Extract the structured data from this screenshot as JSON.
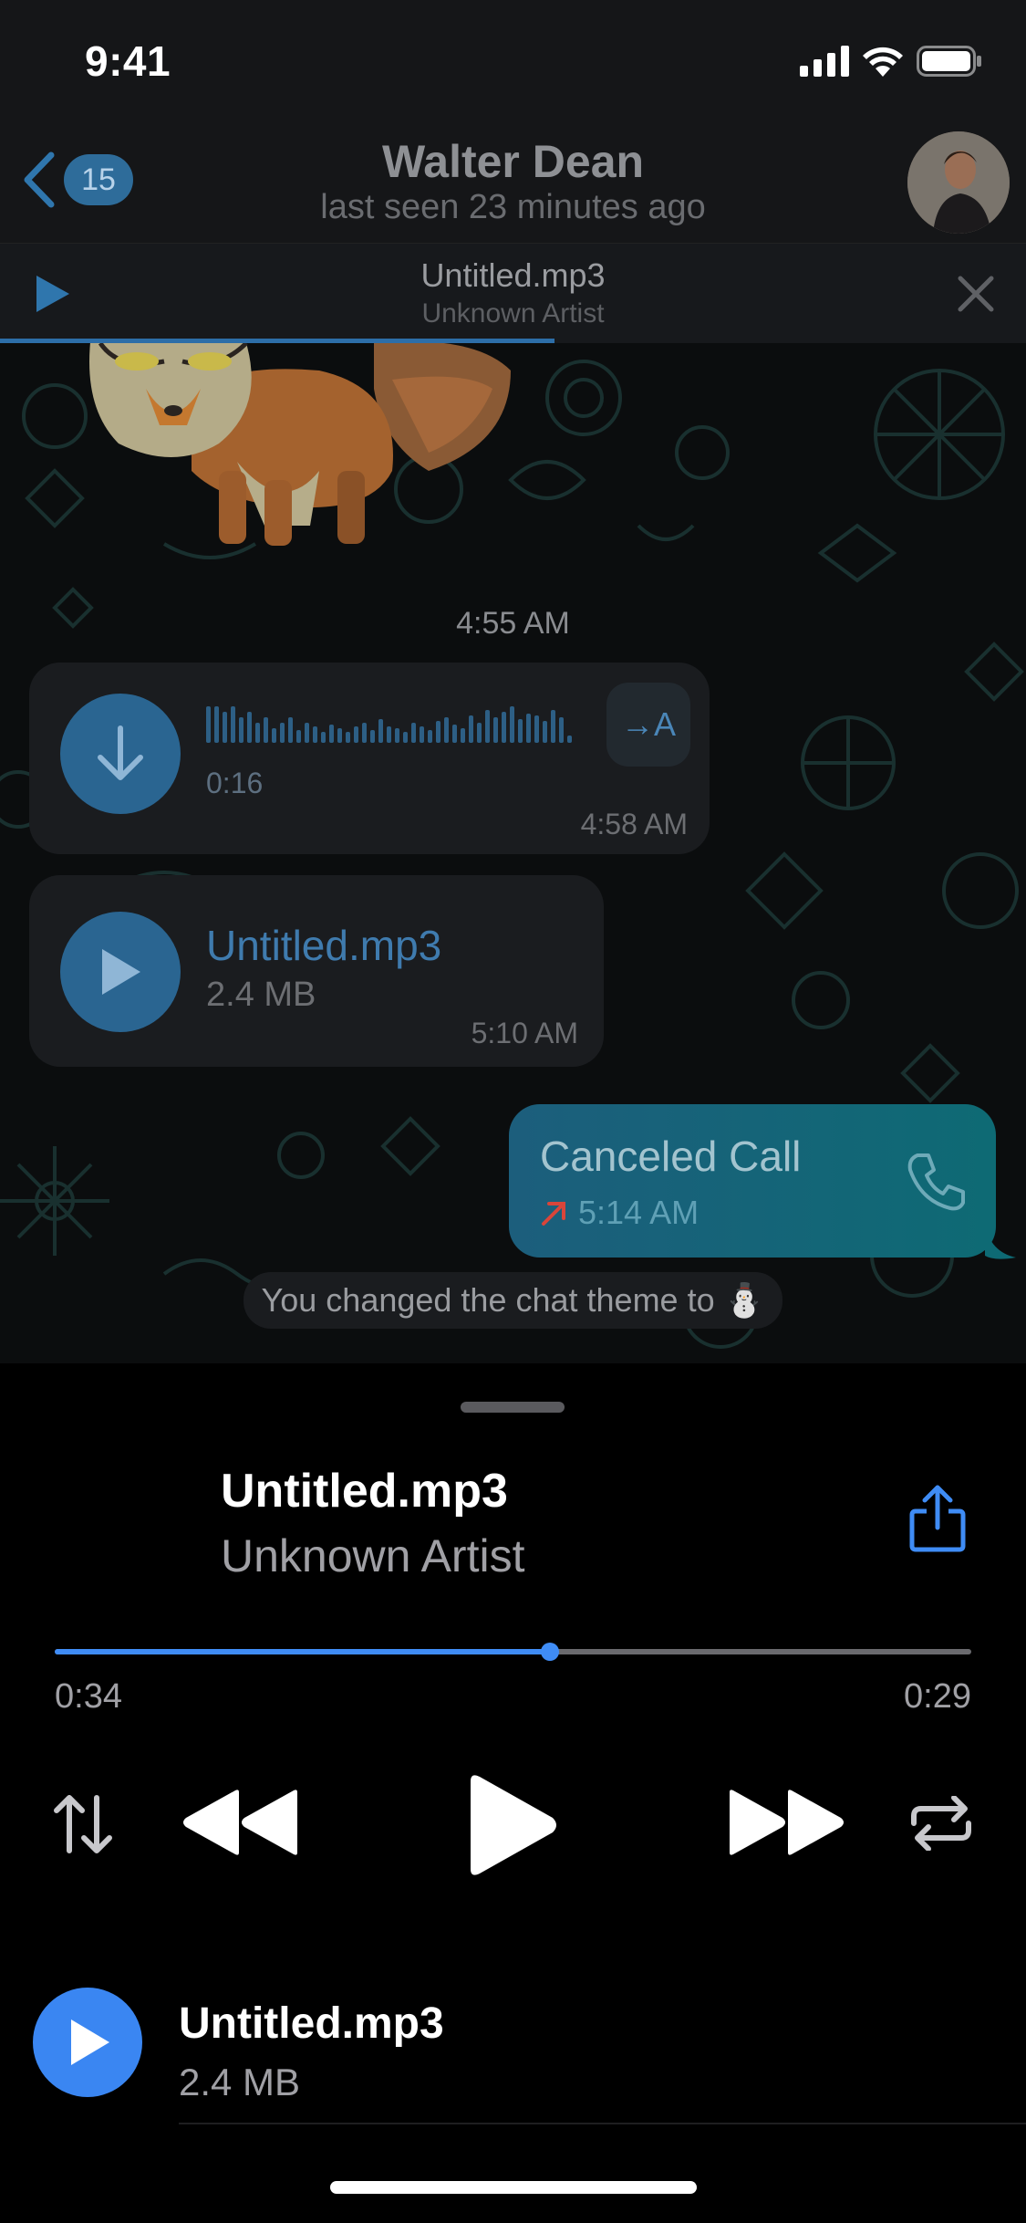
{
  "status_bar": {
    "time": "9:41",
    "icons": [
      "signal-icon",
      "wifi-icon",
      "battery-icon"
    ]
  },
  "header": {
    "back_badge": "15",
    "title": "Walter Dean",
    "subtitle": "last seen 23 minutes ago"
  },
  "mini_player": {
    "title": "Untitled.mp3",
    "artist": "Unknown Artist",
    "progress": 0.54
  },
  "chat": {
    "date_label": "4:55 AM",
    "messages": [
      {
        "type": "voice",
        "duration": "0:16",
        "time": "4:58 AM",
        "transcribe_label": "→A"
      },
      {
        "type": "file",
        "name": "Untitled.mp3",
        "size": "2.4 MB",
        "time": "5:10 AM"
      },
      {
        "type": "call",
        "title": "Canceled Call",
        "time": "5:14 AM"
      }
    ],
    "service_message": "You changed the chat theme to ⛄"
  },
  "player": {
    "title": "Untitled.mp3",
    "artist": "Unknown Artist",
    "progress": 0.54,
    "elapsed": "0:34",
    "remaining": "0:29",
    "controls": [
      "order-icon",
      "rewind-icon",
      "play-icon",
      "fast-forward-icon",
      "repeat-icon"
    ],
    "queue": [
      {
        "title": "Untitled.mp3",
        "size": "2.4 MB"
      }
    ]
  },
  "colors": {
    "accent": "#3f8cf5",
    "outgoing_bubble": "#0e6a74",
    "missed_arrow": "#d9453a"
  }
}
